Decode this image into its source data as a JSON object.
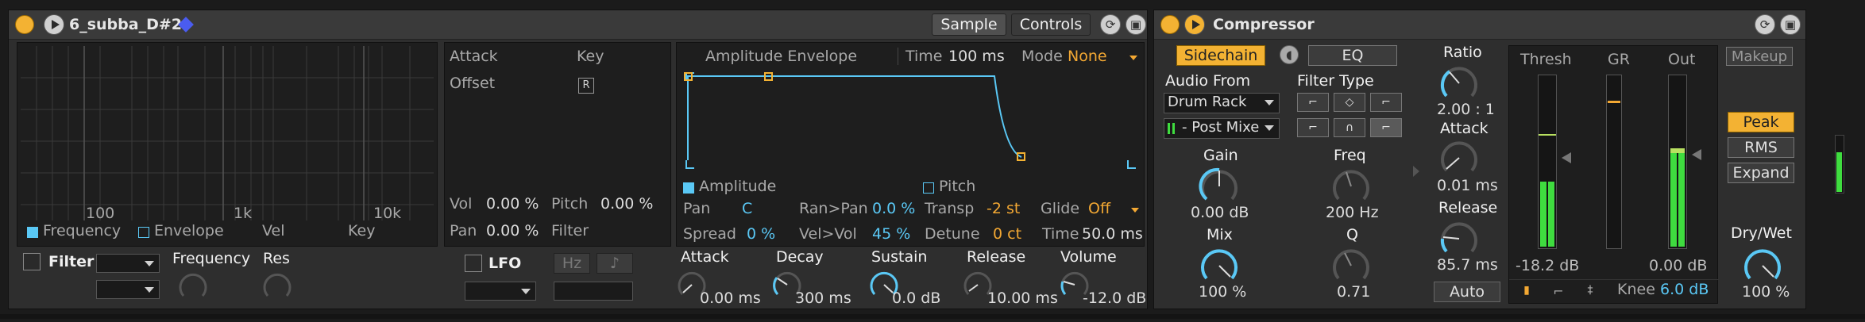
{
  "sampler": {
    "title": "6_subba_D#2",
    "tabs": {
      "sample": "Sample",
      "controls": "Controls"
    },
    "filter_graph": {
      "ticks": [
        "100",
        "1k",
        "10k"
      ],
      "legend": {
        "frequency": "Frequency",
        "envelope": "Envelope",
        "vel": "Vel",
        "key": "Key"
      }
    },
    "filter": {
      "label": "Filter",
      "frequency": "Frequency",
      "res": "Res"
    },
    "modpanel": {
      "attack": "Attack",
      "key": "Key",
      "offset": "Offset",
      "r": "R",
      "vol_label": "Vol",
      "vol_value": "0.00 %",
      "pitch_label": "Pitch",
      "pitch_value": "0.00 %",
      "pan_label": "Pan",
      "pan_value": "0.00 %",
      "filter_label": "Filter"
    },
    "lfo": {
      "label": "LFO",
      "hz": "Hz",
      "note": "♪"
    },
    "envelope": {
      "header": "Amplitude Envelope",
      "time_label": "Time",
      "time_value": "100 ms",
      "mode_label": "Mode",
      "mode_value": "None",
      "amplitude": "Amplitude",
      "pitch": "Pitch",
      "pan_label": "Pan",
      "pan_value": "C",
      "ranpan_label": "Ran>Pan",
      "ranpan_value": "0.0 %",
      "transp_label": "Transp",
      "transp_value": "-2 st",
      "glide_label": "Glide",
      "glide_value": "Off",
      "spread_label": "Spread",
      "spread_value": "0 %",
      "velvol_label": "Vel>Vol",
      "velvol_value": "45 %",
      "detune_label": "Detune",
      "detune_value": "0 ct",
      "gtime_label": "Time",
      "gtime_value": "50.0 ms"
    },
    "adsr": [
      {
        "label": "Attack",
        "value": "0.00 ms"
      },
      {
        "label": "Decay",
        "value": "300 ms"
      },
      {
        "label": "Sustain",
        "value": "0.0 dB"
      },
      {
        "label": "Release",
        "value": "10.00 ms"
      },
      {
        "label": "Volume",
        "value": "-12.0 dB"
      }
    ]
  },
  "compressor": {
    "title": "Compressor",
    "sidechain": "Sidechain",
    "eq": "EQ",
    "audio_from": "Audio From",
    "source": "Drum Rack",
    "post": "- Post Mixe",
    "filter_type": "Filter Type",
    "gain_label": "Gain",
    "gain_value": "0.00 dB",
    "mix_label": "Mix",
    "mix_value": "100 %",
    "freq_label": "Freq",
    "freq_value": "200 Hz",
    "q_label": "Q",
    "q_value": "0.71",
    "ratio_label": "Ratio",
    "ratio_value": "2.00 : 1",
    "attack_label": "Attack",
    "attack_value": "0.01 ms",
    "release_label": "Release",
    "release_value": "85.7 ms",
    "auto": "Auto",
    "thresh_label": "Thresh",
    "gr_label": "GR",
    "out_label": "Out",
    "thresh_value": "-18.2 dB",
    "out_value": "0.00 dB",
    "knee_label": "Knee",
    "knee_value": "6.0 dB",
    "makeup": "Makeup",
    "peak": "Peak",
    "rms": "RMS",
    "expand": "Expand",
    "drywet_label": "Dry/Wet",
    "drywet_value": "100 %"
  },
  "colors": {
    "accent_blue": "#5ac8f5",
    "accent_orange": "#f3b233",
    "meter_green": "#3fdc3f"
  }
}
